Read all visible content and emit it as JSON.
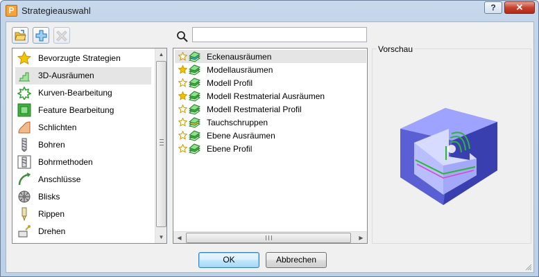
{
  "window": {
    "title": "Strategieauswahl",
    "app_icon": "P",
    "help_label": "?",
    "close_label": "✕"
  },
  "toolbar": {
    "buttons": [
      {
        "icon": "open-folder-icon"
      },
      {
        "icon": "add-plus-icon"
      },
      {
        "icon": "delete-x-icon"
      }
    ]
  },
  "search": {
    "value": "",
    "placeholder": ""
  },
  "categories": {
    "items": [
      {
        "label": "Bevorzugte Strategien",
        "icon": "star-icon"
      },
      {
        "label": "3D-Ausräumen",
        "icon": "area-clear-icon",
        "selected": true
      },
      {
        "label": "Kurven-Bearbeitung",
        "icon": "curve-icon"
      },
      {
        "label": "Feature Bearbeitung",
        "icon": "feature-icon"
      },
      {
        "label": "Schlichten",
        "icon": "finishing-icon"
      },
      {
        "label": "Bohren",
        "icon": "drill-icon"
      },
      {
        "label": "Bohrmethoden",
        "icon": "drill-methods-icon"
      },
      {
        "label": "Anschlüsse",
        "icon": "leads-icon"
      },
      {
        "label": "Blisks",
        "icon": "blisk-icon"
      },
      {
        "label": "Rippen",
        "icon": "rib-icon"
      },
      {
        "label": "Drehen",
        "icon": "turning-icon"
      }
    ]
  },
  "strategies": {
    "items": [
      {
        "label": "Eckenausräumen",
        "favorite": false,
        "icon": "corner-clear-icon",
        "selected": true
      },
      {
        "label": "Modellausräumen",
        "favorite": true,
        "icon": "model-area-clear-icon"
      },
      {
        "label": "Modell Profil",
        "favorite": false,
        "icon": "model-profile-icon"
      },
      {
        "label": "Modell Restmaterial Ausräumen",
        "favorite": true,
        "icon": "model-rest-area-clear-icon"
      },
      {
        "label": "Modell Restmaterial Profil",
        "favorite": false,
        "icon": "model-rest-profile-icon"
      },
      {
        "label": "Tauchschruppen",
        "favorite": false,
        "icon": "plunge-milling-icon"
      },
      {
        "label": "Ebene Ausräumen",
        "favorite": false,
        "icon": "plane-area-clear-icon"
      },
      {
        "label": "Ebene Profil",
        "favorite": false,
        "icon": "plane-profile-icon"
      }
    ]
  },
  "preview": {
    "label": "Vorschau"
  },
  "buttons": {
    "ok": "OK",
    "cancel": "Abbrechen"
  },
  "colors": {
    "selection": "#e5e5e5",
    "star": "#f2c200",
    "preview_block": "#5f63c8",
    "toolpath_green": "#2fb534"
  }
}
